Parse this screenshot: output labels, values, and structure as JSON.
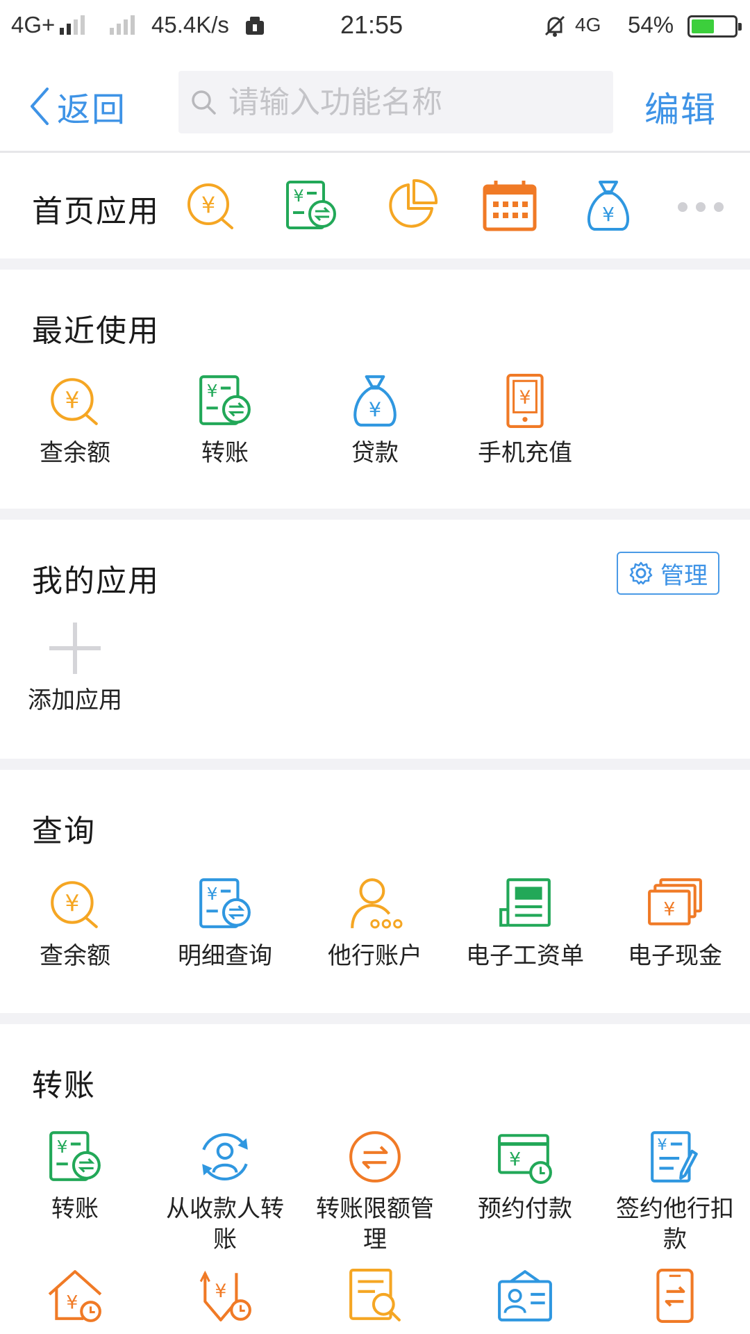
{
  "status_bar": {
    "network_left": "4G+",
    "speed": "45.4K/s",
    "time": "21:55",
    "network_right": "4G",
    "battery": "54%",
    "battery_level": 54
  },
  "header": {
    "back_label": "返回",
    "search_placeholder": "请输入功能名称",
    "edit_label": "编辑"
  },
  "home_apps": {
    "label": "首页应用",
    "icons": [
      "balance-query-icon",
      "transfer-icon",
      "pie-chart-icon",
      "calendar-icon",
      "money-bag-icon"
    ]
  },
  "recent": {
    "title": "最近使用",
    "items": [
      {
        "label": "查余额",
        "icon": "balance-query-icon"
      },
      {
        "label": "转账",
        "icon": "transfer-icon"
      },
      {
        "label": "贷款",
        "icon": "money-bag-icon"
      },
      {
        "label": "手机充值",
        "icon": "phone-recharge-icon"
      }
    ]
  },
  "my_apps": {
    "title": "我的应用",
    "manage_label": "管理",
    "add_label": "添加应用"
  },
  "query": {
    "title": "查询",
    "items": [
      {
        "label": "查余额",
        "icon": "balance-query-icon"
      },
      {
        "label": "明细查询",
        "icon": "statement-icon"
      },
      {
        "label": "他行账户",
        "icon": "other-bank-account-icon"
      },
      {
        "label": "电子工资单",
        "icon": "payslip-icon"
      },
      {
        "label": "电子现金",
        "icon": "e-cash-icon"
      }
    ]
  },
  "transfer": {
    "title": "转账",
    "items": [
      {
        "label": "转账",
        "icon": "transfer-icon"
      },
      {
        "label": "从收款人转账",
        "icon": "payee-transfer-icon"
      },
      {
        "label": "转账限额管理",
        "icon": "transfer-limit-icon"
      },
      {
        "label": "预约付款",
        "icon": "scheduled-payment-icon"
      },
      {
        "label": "签约他行扣款",
        "icon": "sign-debit-icon"
      }
    ],
    "row2_icons": [
      "house-loan-icon",
      "refund-schedule-icon",
      "document-search-icon",
      "id-card-icon",
      "phone-transfer-icon"
    ]
  },
  "colors": {
    "accent": "#3e93e6",
    "orange": "#f5a623",
    "green": "#22a858",
    "blue": "#2f97e0",
    "red_orange": "#f07a26"
  }
}
